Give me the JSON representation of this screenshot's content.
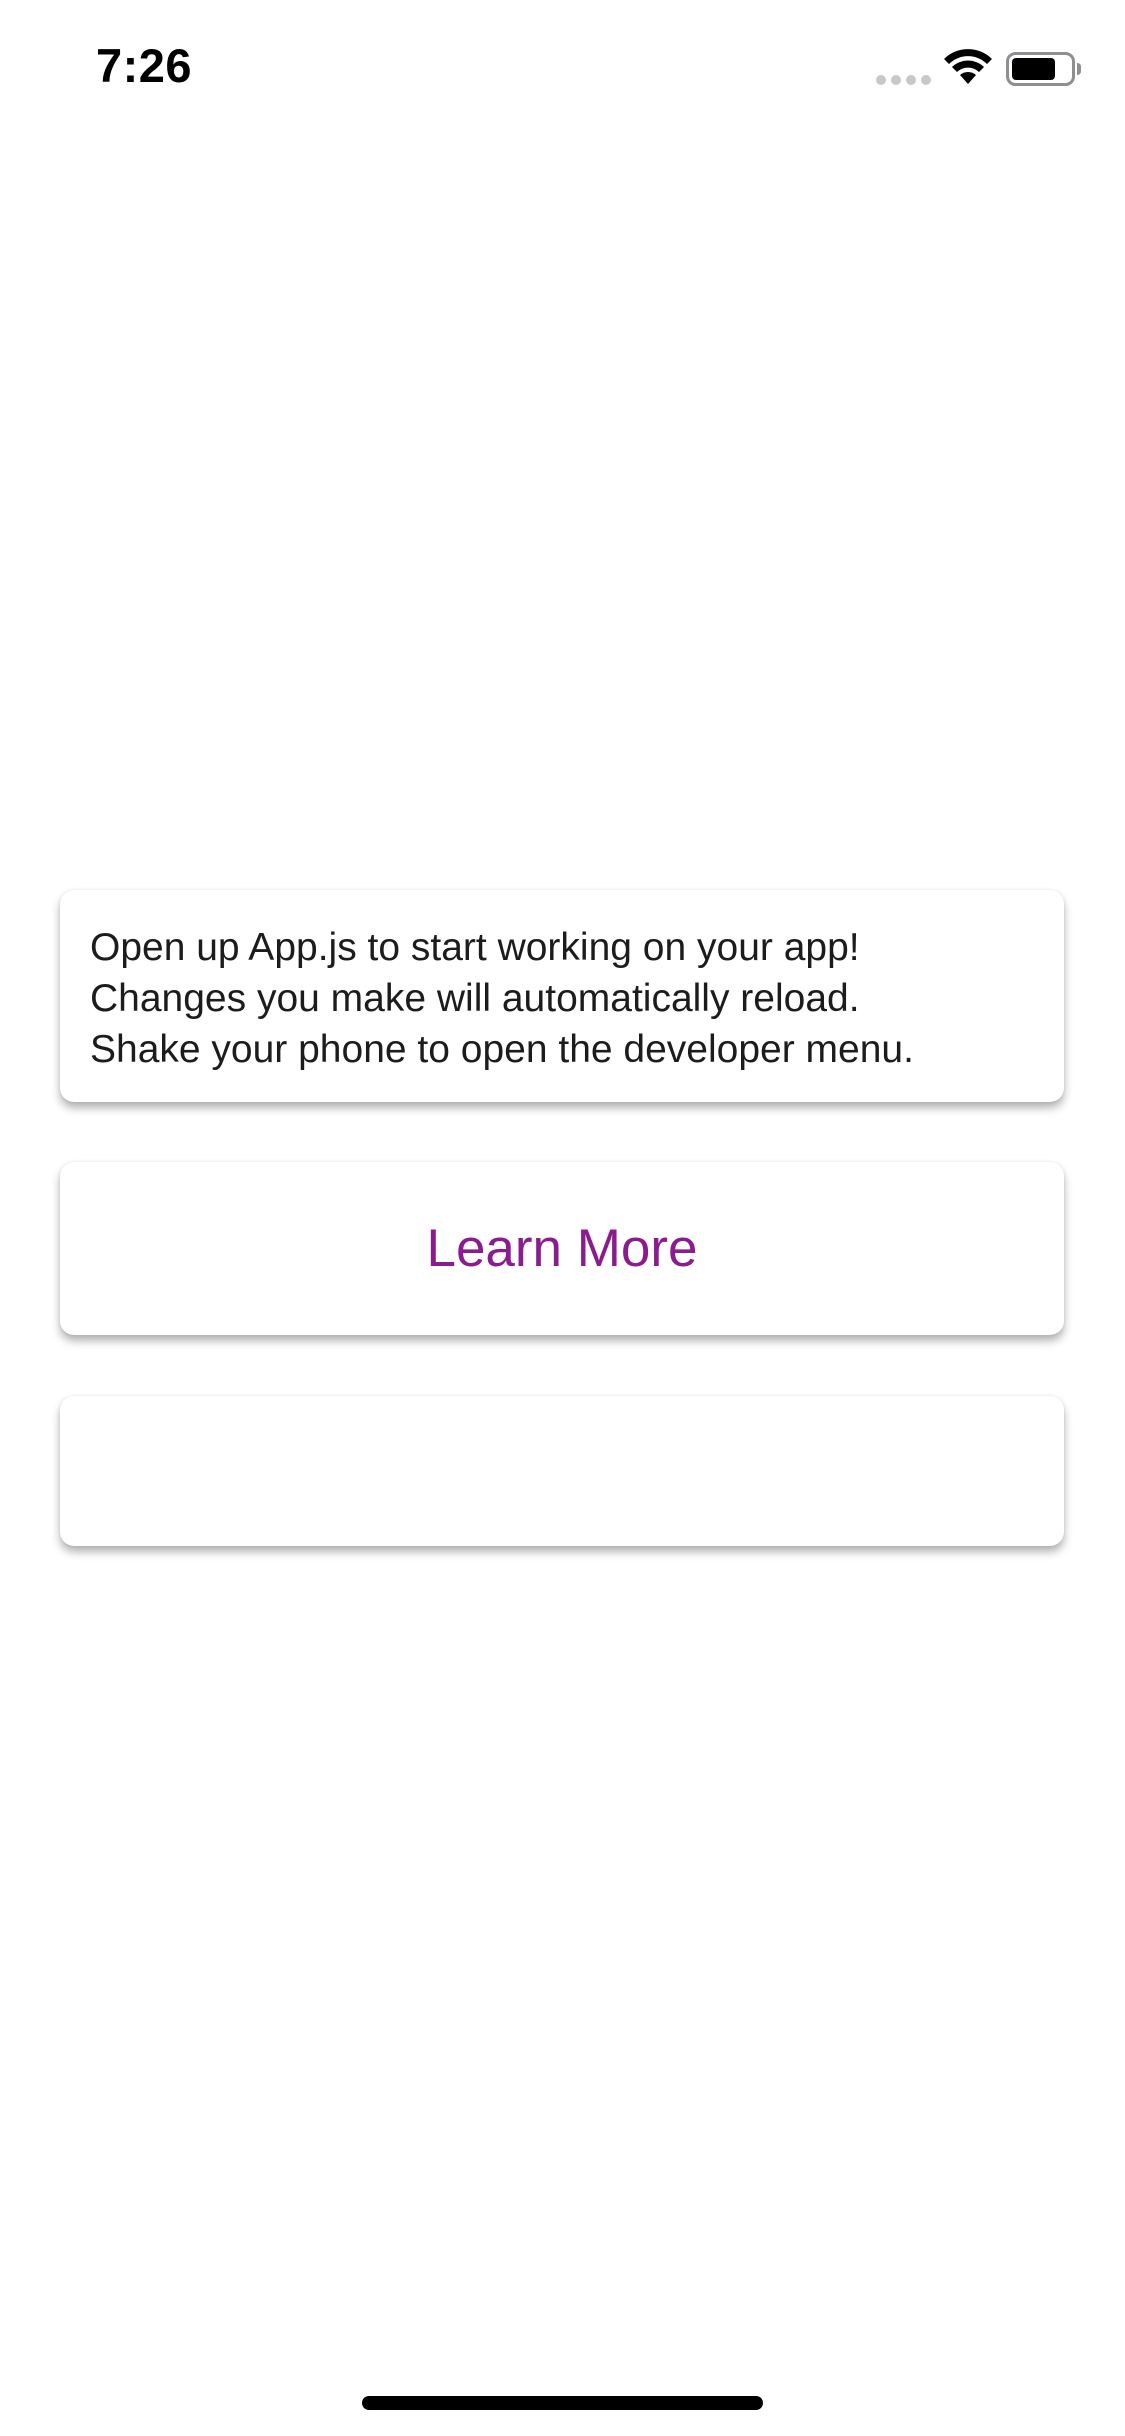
{
  "status_bar": {
    "time": "7:26"
  },
  "info_card": {
    "lines": [
      "Open up App.js to start working on your app!",
      "Changes you make will automatically reload.",
      "Shake your phone to open the developer menu."
    ]
  },
  "learn_more": {
    "label": "Learn More",
    "color": "#8a1c8e"
  },
  "icons": {
    "signal": "signal-icon",
    "wifi": "wifi-icon",
    "battery": "battery-icon"
  }
}
